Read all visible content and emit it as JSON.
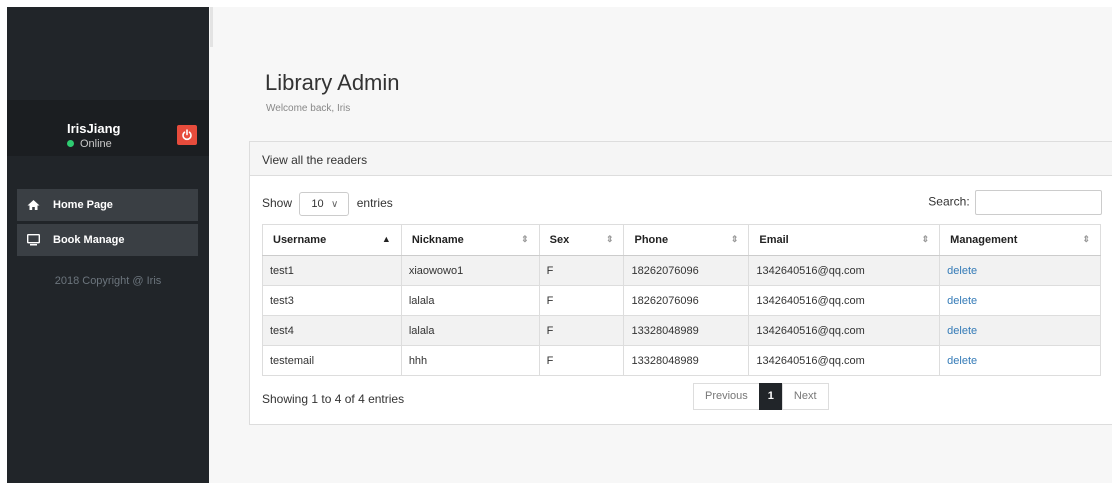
{
  "sidebar": {
    "user_name": "IrisJiang",
    "status": "Online",
    "nav": [
      {
        "label": "Home Page",
        "icon": "home-icon"
      },
      {
        "label": "Book Manage",
        "icon": "monitor-icon"
      }
    ],
    "copyright": "2018 Copyright @ Iris"
  },
  "header": {
    "title": "Library Admin",
    "subtitle": "Welcome back, Iris"
  },
  "panel": {
    "heading": "View all the readers",
    "length_prefix": "Show",
    "length_value": "10",
    "length_suffix": "entries",
    "search_label": "Search:",
    "search_value": ""
  },
  "table": {
    "columns": [
      "Username",
      "Nickname",
      "Sex",
      "Phone",
      "Email",
      "Management"
    ],
    "rows": [
      [
        "test1",
        "xiaowowo1",
        "F",
        "18262076096",
        "1342640516@qq.com",
        "delete"
      ],
      [
        "test3",
        "lalala",
        "F",
        "18262076096",
        "1342640516@qq.com",
        "delete"
      ],
      [
        "test4",
        "lalala",
        "F",
        "13328048989",
        "1342640516@qq.com",
        "delete"
      ],
      [
        "testemail",
        "hhh",
        "F",
        "13328048989",
        "1342640516@qq.com",
        "delete"
      ]
    ]
  },
  "footer": {
    "info": "Showing 1 to 4 of 4 entries",
    "previous": "Previous",
    "current_page": "1",
    "next": "Next"
  },
  "colors": {
    "sidebar_bg": "#212529",
    "accent_red": "#e74c3c",
    "link": "#337ab7",
    "online": "#2ecc71"
  }
}
